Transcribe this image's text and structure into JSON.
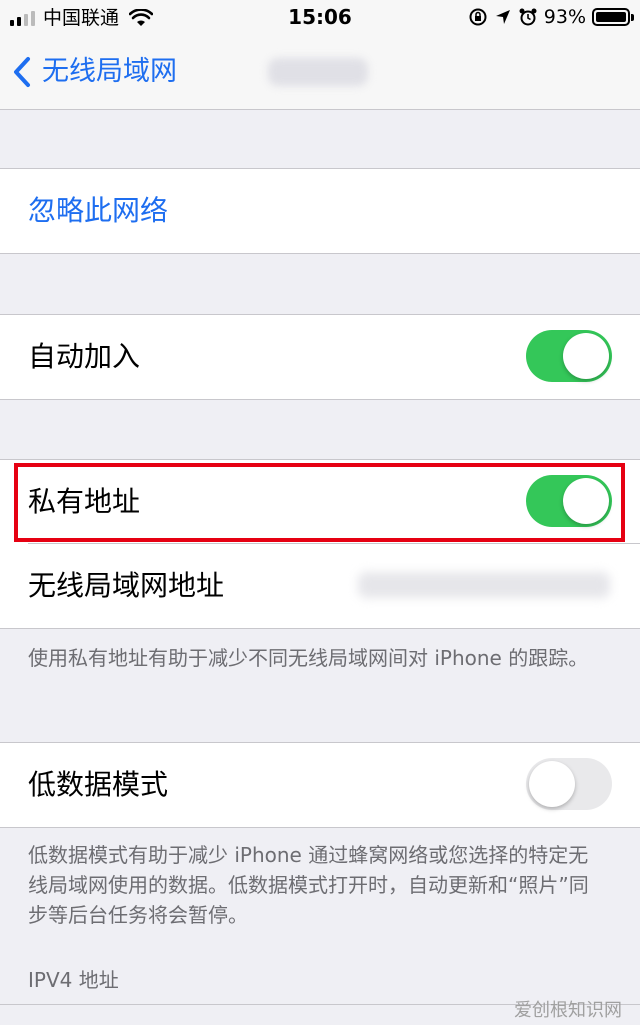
{
  "status_bar": {
    "carrier": "中国联通",
    "time": "15:06",
    "battery": "93%",
    "battery_level": 0.93,
    "icons": [
      "signal-icon",
      "wifi-icon",
      "orientation-lock-icon",
      "location-icon",
      "alarm-icon",
      "battery-icon"
    ]
  },
  "nav": {
    "back_label": "无线局域网"
  },
  "forget": {
    "label": "忽略此网络"
  },
  "auto_join": {
    "label": "自动加入",
    "on": true
  },
  "private_address": {
    "label": "私有地址",
    "on": true
  },
  "wifi_address": {
    "label": "无线局域网地址"
  },
  "private_footnote": "使用私有地址有助于减少不同无线局域网间对 iPhone 的跟踪。",
  "low_data": {
    "label": "低数据模式",
    "on": false
  },
  "low_data_footnote": "低数据模式有助于减少 iPhone 通过蜂窝网络或您选择的特定无线局域网使用的数据。低数据模式打开时，自动更新和“照片”同步等后台任务将会暂停。",
  "ipv4_header": "IPV4 地址",
  "watermark": "爱创根知识网",
  "colors": {
    "accent": "#1e6ef0",
    "toggle_on": "#34c759",
    "toggle_off": "#e9e9eb",
    "highlight": "#e60012"
  }
}
